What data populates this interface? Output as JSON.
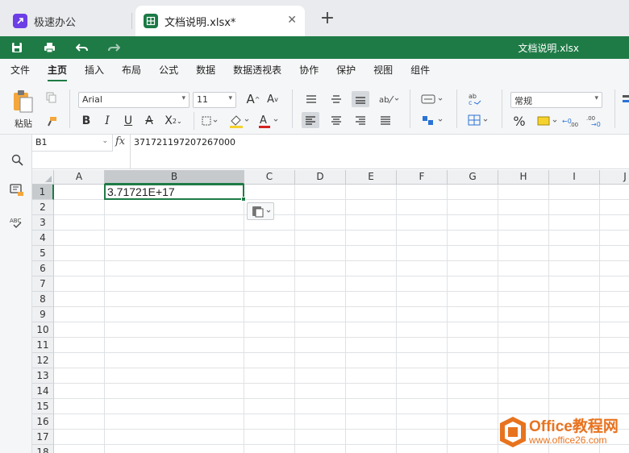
{
  "tabs": {
    "inactive_label": "极速办公",
    "active_label": "文档说明.xlsx*",
    "close_glyph": "✕",
    "new_tab_glyph": "+"
  },
  "quickbar": {
    "doc_title": "文档说明.xlsx"
  },
  "menu": [
    {
      "label": "文件"
    },
    {
      "label": "主页"
    },
    {
      "label": "插入"
    },
    {
      "label": "布局"
    },
    {
      "label": "公式"
    },
    {
      "label": "数据"
    },
    {
      "label": "数据透视表"
    },
    {
      "label": "协作"
    },
    {
      "label": "保护"
    },
    {
      "label": "视图"
    },
    {
      "label": "组件"
    }
  ],
  "menu_active_index": 1,
  "ribbon": {
    "paste_label": "粘贴",
    "font_name": "Arial",
    "font_size": "11",
    "number_format": "常规",
    "percent_glyph": "%"
  },
  "formula_bar": {
    "name_box": "B1",
    "fx_label": "fx",
    "value": "371721197207267000"
  },
  "grid": {
    "columns": [
      "A",
      "B",
      "C",
      "D",
      "E",
      "F",
      "G",
      "H",
      "I",
      "J"
    ],
    "rows": [
      "1",
      "2",
      "3",
      "4",
      "5",
      "6",
      "7",
      "8",
      "9",
      "10",
      "11",
      "12",
      "13",
      "14",
      "15",
      "16",
      "17",
      "18"
    ],
    "selected_cell": "B1",
    "cell_b1_display": "3.71721E+17"
  },
  "watermark": {
    "line1": "Office教程网",
    "line2": "www.office26.com"
  },
  "colors": {
    "brand_green": "#1e7b46",
    "purple": "#6b3ee6",
    "watermark_orange": "#e8731f"
  }
}
